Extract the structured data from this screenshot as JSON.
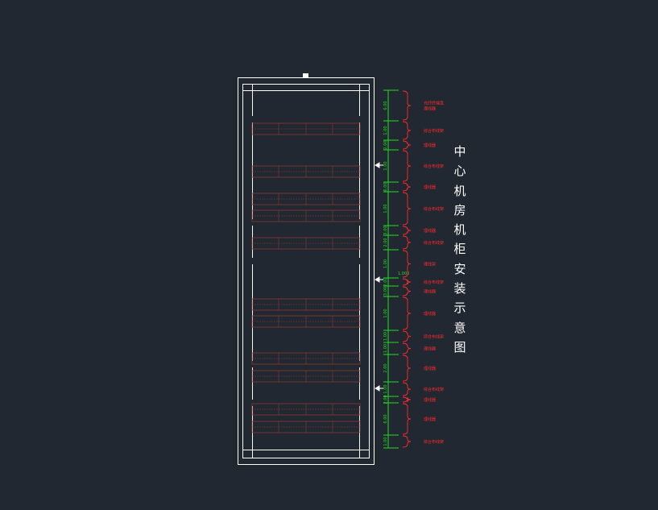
{
  "title_chars": [
    "中",
    "心",
    "机",
    "房",
    "机",
    "柜",
    "安",
    "装",
    "示",
    "意",
    "图"
  ],
  "colors": {
    "background": "#222831",
    "frame": "#ffffff",
    "dimension": "#22dd22",
    "label": "#ff2a2a",
    "equipment": "#8a3a30"
  },
  "cabinet_labels": [
    "光纤终端盒\n理线器",
    "综合布线架",
    "理线器",
    "综合布线架",
    "理线器",
    "综合布线架",
    "理线器",
    "综合布线架",
    "理线架",
    "综合布线架",
    "理线器",
    "理线器",
    "综合布线架",
    "理线器",
    "理线器",
    "综合布线架",
    "理线器",
    "理线器",
    "综合布线架",
    "理线器",
    "空余"
  ],
  "dimension_text": [
    "6.00",
    "1.00",
    "2.00",
    "1.00",
    "6.00",
    "1.00",
    "3.00",
    "2.00",
    "1.00",
    "2.00",
    "3.00",
    "1.00",
    "1.00",
    "1.00",
    "2.00",
    "1.00",
    "2.00",
    "6.00",
    "1.00",
    "2.00",
    "1.00",
    "6.00",
    "1.00",
    "2.00",
    "3.00",
    "1.00"
  ],
  "equipment_rows": 10
}
